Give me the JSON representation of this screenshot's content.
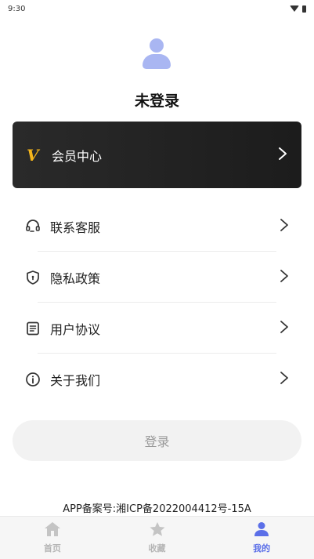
{
  "status": {
    "time": "9:30"
  },
  "profile": {
    "name": "未登录"
  },
  "vip": {
    "label": "会员中心",
    "arrow": "›",
    "icon": "V"
  },
  "menu": [
    {
      "label": "联系客服",
      "icon": "headset-icon"
    },
    {
      "label": "隐私政策",
      "icon": "shield-icon"
    },
    {
      "label": "用户协议",
      "icon": "document-icon"
    },
    {
      "label": "关于我们",
      "icon": "info-icon"
    }
  ],
  "login": {
    "label": "登录"
  },
  "footer": {
    "icp": "APP备案号:湘ICP备2022004412号-15A"
  },
  "tabs": [
    {
      "label": "首页",
      "icon": "home-icon",
      "active": false
    },
    {
      "label": "收藏",
      "icon": "star-icon",
      "active": false
    },
    {
      "label": "我的",
      "icon": "user-icon",
      "active": true
    }
  ],
  "colors": {
    "accent": "#5b6fe8",
    "vip_gold": "#f5b51b",
    "avatar": "#a9b6f2"
  }
}
